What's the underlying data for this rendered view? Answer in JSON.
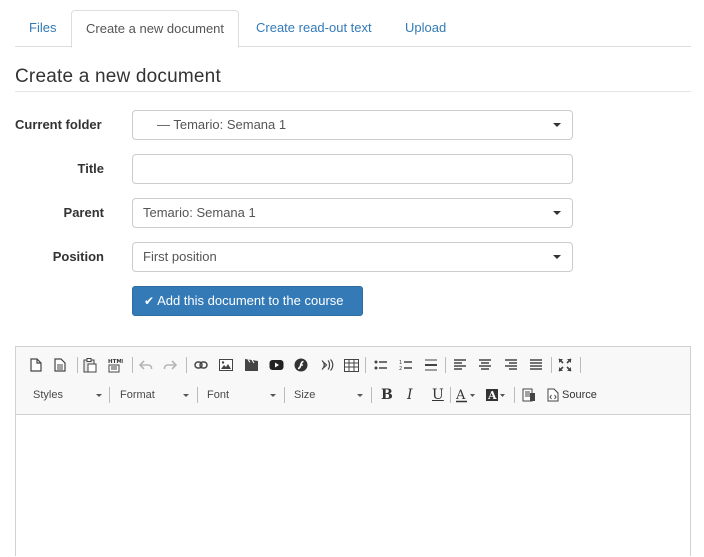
{
  "tabs": [
    {
      "label": "Files"
    },
    {
      "label": "Create a new document"
    },
    {
      "label": "Create read-out text"
    },
    {
      "label": "Upload"
    }
  ],
  "active_tab": "Create a new document",
  "heading": "Create a new document",
  "form": {
    "current_folder": {
      "label": "Current folder",
      "value": "— Temario: Semana 1"
    },
    "title": {
      "label": "Title",
      "value": "",
      "placeholder": ""
    },
    "parent": {
      "label": "Parent",
      "value": "Temario: Semana 1"
    },
    "position": {
      "label": "Position",
      "value": "First position"
    },
    "submit_label": "Add this document to the course"
  },
  "editor": {
    "combos": {
      "styles": "Styles",
      "format": "Format",
      "font": "Font",
      "size": "Size"
    },
    "source_label": "Source",
    "toolbar_icons": [
      "new-page-icon",
      "templates-icon",
      "paste-icon",
      "paste-from-html-icon",
      "undo-icon",
      "redo-icon",
      "link-icon",
      "image-icon",
      "video-icon",
      "youtube-icon",
      "flash-icon",
      "audio-icon",
      "table-icon",
      "bulleted-list-icon",
      "numbered-list-icon",
      "horizontal-rule-icon",
      "align-left-icon",
      "align-center-icon",
      "align-right-icon",
      "justify-icon",
      "maximize-icon",
      "bold-icon",
      "italic-icon",
      "underline-icon",
      "text-color-icon",
      "background-color-icon",
      "select-all-icon",
      "source-icon"
    ]
  },
  "colors": {
    "link": "#337ab7",
    "primary_button": "#337ab7",
    "toolbar_bg": "#f8f8f8"
  }
}
